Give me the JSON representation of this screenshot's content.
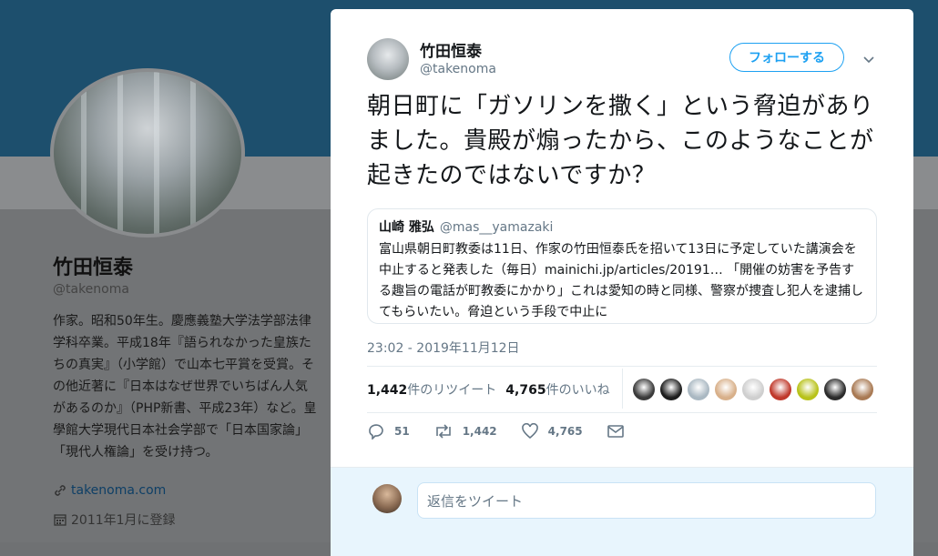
{
  "profile": {
    "name": "竹田恒泰",
    "handle": "@takenoma",
    "bio": "作家。昭和50年生。慶應義塾大学法学部法律学科卒業。平成18年『語られなかった皇族たちの真実』（小学館）で山本七平賞を受賞。その他近著に『日本はなぜ世界でいちばん人気があるのか』（PHP新書、平成23年）など。皇學館大学現代日本社会学部で「日本国家論」「現代人権論」を受け持つ。",
    "link": "takenoma.com",
    "joined": "2011年1月に登録"
  },
  "tweet": {
    "author_name": "竹田恒泰",
    "author_handle": "@takenoma",
    "follow_label": "フォローする",
    "text": "朝日町に「ガソリンを撒く」という脅迫がありました。貴殿が煽ったから、このようなことが起きたのではないですか？",
    "quote": {
      "author_name": "山崎 雅弘",
      "author_handle": "@mas__yamazaki",
      "text": "富山県朝日町教委は11日、作家の竹田恒泰氏を招いて13日に予定していた講演会を中止すると発表した（毎日）mainichi.jp/articles/20191… 「開催の妨害を予告する趣旨の電話が町教委にかかり」これは愛知の時と同様、警察が捜査し犯人を逮捕してもらいたい。脅迫という手段で中止に"
    },
    "timestamp": "23:02 - 2019年11月12日",
    "retweets_count": "1,442",
    "retweets_label": "件のリツイート",
    "likes_count": "4,765",
    "likes_label": "件のいいね",
    "reply_count": "51",
    "retweet_action_count": "1,442",
    "like_action_count": "4,765"
  },
  "likers": [
    "#3a3a3a",
    "#1e1e1e",
    "#aab8c2",
    "#d8b08a",
    "#cfcfcf",
    "#c0392b",
    "#b8c21a",
    "#2b2b2b",
    "#a97a54"
  ],
  "reply": {
    "placeholder": "返信をツイート"
  },
  "colors": {
    "accent": "#1da1f2",
    "secondary_text": "#657786",
    "banner": "#1d4f6d"
  }
}
